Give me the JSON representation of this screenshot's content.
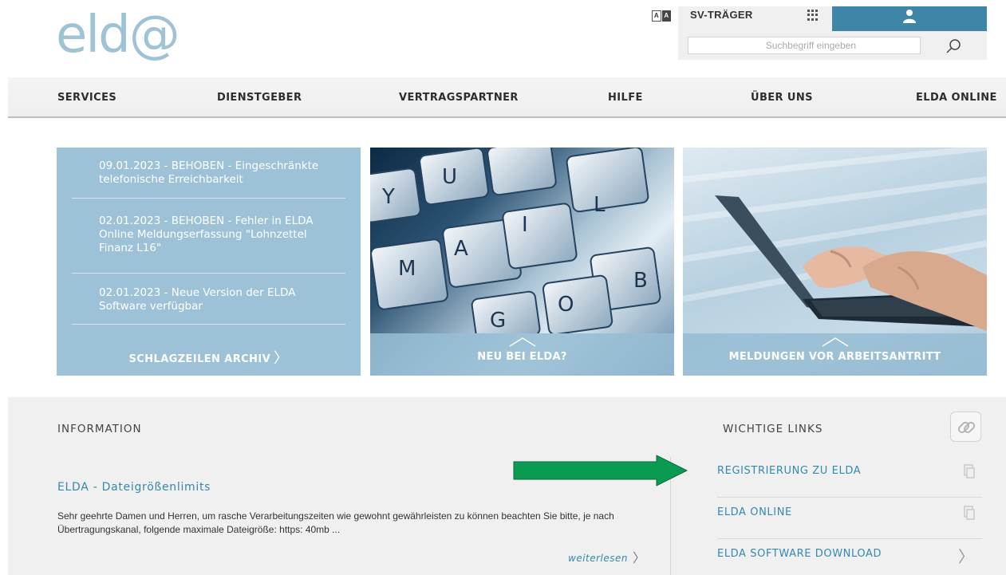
{
  "logo": {
    "text": "eld@"
  },
  "topbar": {
    "font_toggle": [
      "A",
      "A"
    ],
    "sv_label": "SV-TRÄGER",
    "search_placeholder": "Suchbegriff eingeben",
    "brand_color": "#3d86a8"
  },
  "nav": {
    "items": [
      {
        "label": "SERVICES"
      },
      {
        "label": "DIENSTGEBER"
      },
      {
        "label": "VERTRAGSPARTNER"
      },
      {
        "label": "HILFE"
      },
      {
        "label": "ÜBER UNS"
      },
      {
        "label": "ELDA ONLINE"
      }
    ]
  },
  "news": {
    "items": [
      {
        "text": "09.01.2023 - BEHOBEN - Eingeschränkte telefonische Erreichbarkeit"
      },
      {
        "text": "02.01.2023 - BEHOBEN - Fehler in ELDA Online Meldungserfassung \"Lohnzettel Finanz L16\""
      },
      {
        "text": "02.01.2023 - Neue Version der ELDA Software verfügbar"
      }
    ],
    "archive_label": "SCHLAGZEILEN ARCHIV",
    "tile_color": "#9dc2d7"
  },
  "tiles": {
    "mail": {
      "caption": "NEU BEI ELDA?",
      "key_letters": [
        "Y",
        "U",
        "L",
        "M",
        "A",
        "I",
        "B",
        "O",
        "G"
      ]
    },
    "laptop": {
      "caption": "MELDUNGEN VOR ARBEITSANTRITT"
    }
  },
  "information": {
    "heading": "INFORMATION",
    "article_title": "ELDA - Dateigrößenlimits",
    "article_body": "Sehr geehrte Damen und Herren,  um rasche Verarbeitungszeiten wie gewohnt gewährleisten zu können beachten Sie bitte, je nach Übertragungskanal, folgende maximale Dateigröße:  https: 40mb ...",
    "read_more": "weiterlesen"
  },
  "links": {
    "heading": "WICHTIGE LINKS",
    "items": [
      {
        "label": "REGISTRIERUNG ZU ELDA",
        "icon": "document-icon"
      },
      {
        "label": "ELDA ONLINE",
        "icon": "document-icon"
      },
      {
        "label": "ELDA SOFTWARE DOWNLOAD",
        "icon": "chevron-right-icon"
      }
    ],
    "link_color": "#3589ad"
  },
  "annotation": {
    "arrow_color": "#0a9a52"
  }
}
